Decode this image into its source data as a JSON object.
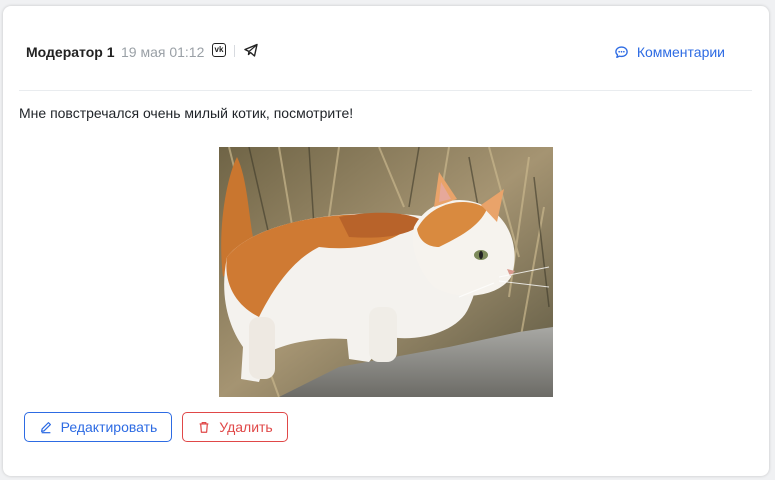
{
  "post": {
    "author": "Модератор 1",
    "date": "19 мая 01:12",
    "text": "Мне повстречался очень милый котик, посмотрите!",
    "image_alt": "cat-photo"
  },
  "header": {
    "comments_label": "Комментарии",
    "share_icons": [
      "vk-icon",
      "telegram-icon"
    ]
  },
  "actions": {
    "edit_label": "Редактировать",
    "delete_label": "Удалить"
  },
  "colors": {
    "accent": "#2d6be3",
    "danger": "#e04848",
    "muted": "#9aa0a6"
  }
}
